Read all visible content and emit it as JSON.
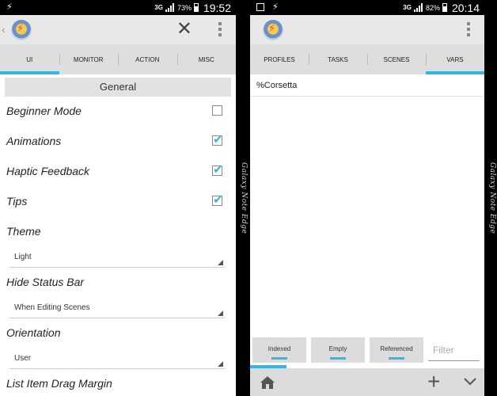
{
  "left_phone": {
    "status": {
      "network": "3G",
      "battery": "73%",
      "time": "19:52"
    },
    "tabs": [
      {
        "label": "UI",
        "active": true
      },
      {
        "label": "MONITOR",
        "active": false
      },
      {
        "label": "ACTION",
        "active": false
      },
      {
        "label": "MISC",
        "active": false
      }
    ],
    "section_title": "General",
    "prefs": {
      "beginner_mode": {
        "label": "Beginner Mode",
        "checked": false
      },
      "animations": {
        "label": "Animations",
        "checked": true
      },
      "haptic": {
        "label": "Haptic Feedback",
        "checked": true
      },
      "tips": {
        "label": "Tips",
        "checked": true
      },
      "theme": {
        "label": "Theme",
        "value": "Light"
      },
      "hide_status_bar": {
        "label": "Hide Status Bar",
        "value": "When Editing Scenes"
      },
      "orientation": {
        "label": "Orientation",
        "value": "User"
      },
      "drag_margin": {
        "label": "List Item Drag Margin"
      }
    }
  },
  "right_phone": {
    "status": {
      "network": "3G",
      "battery": "82%",
      "time": "20:14"
    },
    "tabs": [
      {
        "label": "PROFILES",
        "active": false
      },
      {
        "label": "TASKS",
        "active": false
      },
      {
        "label": "SCENES",
        "active": false
      },
      {
        "label": "VARS",
        "active": true
      }
    ],
    "variables": [
      "%Corsetta"
    ],
    "filter_buttons": [
      "Indexed",
      "Empty",
      "Referenced"
    ],
    "filter_placeholder": "Filter"
  },
  "bezel_text": "Galaxy Note Edge",
  "colors": {
    "accent": "#33b5e5",
    "appbar": "#e8e8e8",
    "tabbar": "#dedede"
  },
  "icons": [
    "lightning-icon",
    "signal-icon",
    "battery-icon",
    "close-icon",
    "overflow-menu-icon",
    "home-icon",
    "plus-icon",
    "chevron-down-icon",
    "checkbox-icon"
  ]
}
